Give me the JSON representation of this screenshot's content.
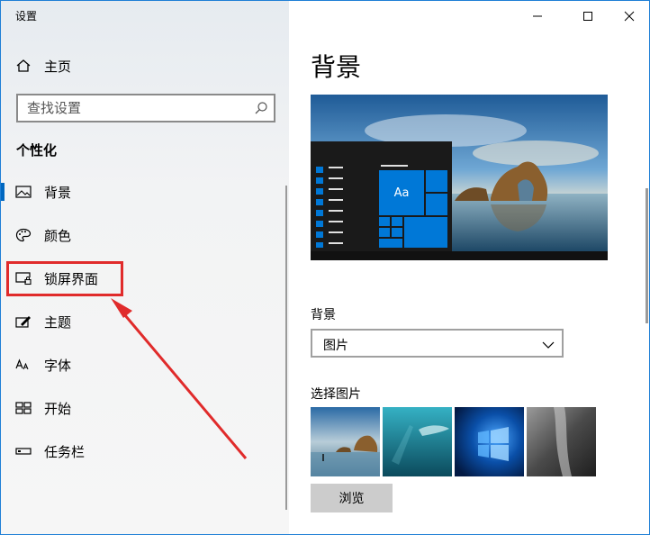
{
  "window": {
    "title": "设置",
    "controls": {
      "minimize_icon": "minimize-icon",
      "maximize_icon": "maximize-icon",
      "close_icon": "close-icon"
    }
  },
  "sidebar": {
    "home_label": "主页",
    "search_placeholder": "查找设置",
    "section_title": "个性化",
    "selected_item": "背景",
    "items": [
      {
        "label": "背景",
        "icon": "picture-icon"
      },
      {
        "label": "颜色",
        "icon": "palette-icon"
      },
      {
        "label": "锁屏界面",
        "icon": "lock-screen-icon"
      },
      {
        "label": "主题",
        "icon": "theme-icon"
      },
      {
        "label": "字体",
        "icon": "font-icon"
      },
      {
        "label": "开始",
        "icon": "start-icon"
      },
      {
        "label": "任务栏",
        "icon": "taskbar-icon"
      }
    ]
  },
  "annotation": {
    "highlighted_item": "锁屏界面",
    "color": "#e02b2b"
  },
  "content": {
    "page_title": "背景",
    "preview": {
      "tile_text": "Aa"
    },
    "background_label": "背景",
    "background_value": "图片",
    "choose_picture_label": "选择图片",
    "browse_label": "浏览"
  },
  "colors": {
    "accent": "#0067c0",
    "tile_blue": "#0078d7",
    "highlight_red": "#e02b2b"
  }
}
